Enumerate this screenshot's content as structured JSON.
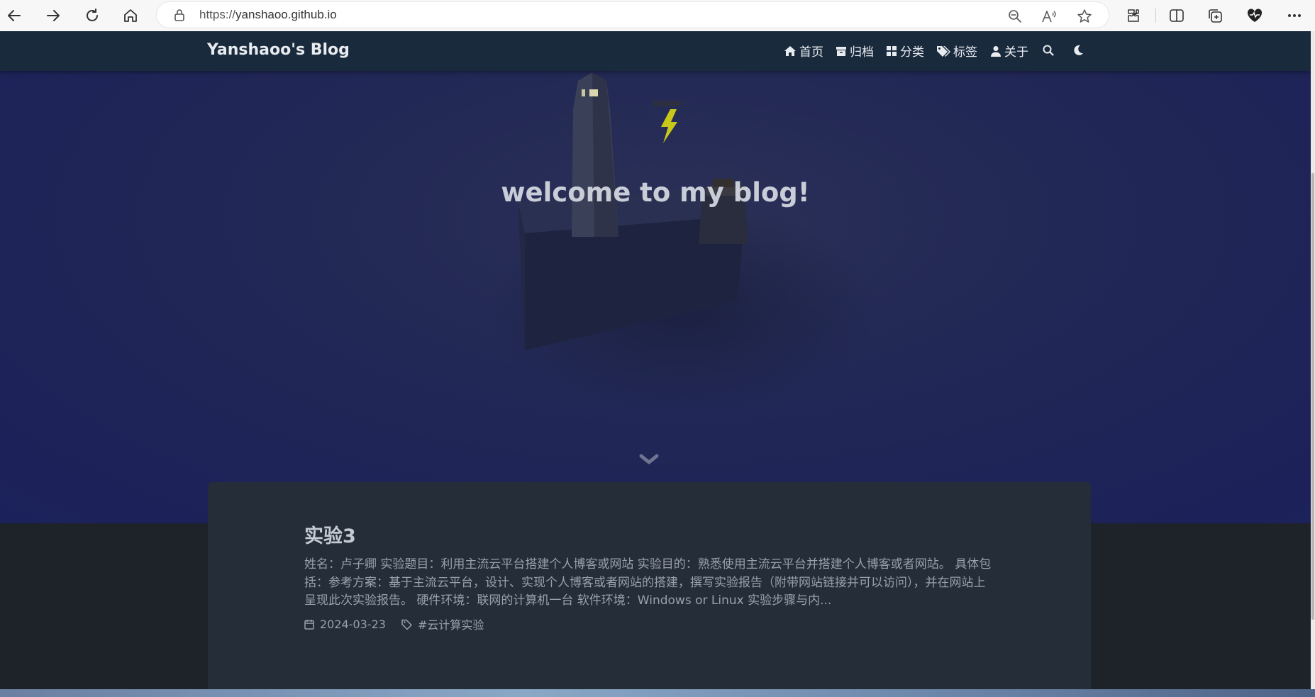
{
  "browser": {
    "url_protocol": "https://",
    "url_host": "yanshaoo.github.io",
    "icons": [
      "back-icon",
      "forward-icon",
      "refresh-icon",
      "home-icon",
      "lock-icon",
      "zoom-out-icon",
      "read-aloud-icon",
      "favorite-star-icon",
      "extensions-icon",
      "split-screen-icon",
      "collections-icon",
      "browser-essentials-icon",
      "more-icon"
    ]
  },
  "site": {
    "brand": "Yanshaoo's Blog",
    "nav": [
      {
        "label": "首页",
        "icon": "home-icon"
      },
      {
        "label": "归档",
        "icon": "archive-icon"
      },
      {
        "label": "分类",
        "icon": "grid-icon"
      },
      {
        "label": "标签",
        "icon": "tags-icon"
      },
      {
        "label": "关于",
        "icon": "user-icon"
      }
    ],
    "search_icon": "search-icon",
    "theme_icon": "moon-icon"
  },
  "hero": {
    "title": "welcome to my blog!"
  },
  "posts": [
    {
      "title": "实验3",
      "excerpt": "姓名：卢子卿 实验题目：利用主流云平台搭建个人博客或网站 实验目的：熟悉使用主流云平台并搭建个人博客或者网站。 具体包括：参考方案：基于主流云平台，设计、实现个人博客或者网站的搭建，撰写实验报告（附带网站链接并可以访问），并在网站上呈现此次实验报告。 硬件环境：联网的计算机一台 软件环境：Windows or Linux 实验步骤与内...",
      "date": "2024-03-23",
      "tag": "#云计算实验"
    }
  ],
  "colors": {
    "navbar": "#1a2a3d",
    "hero": "#1f2556",
    "card": "#252d38",
    "page_bg": "#1e2229"
  }
}
